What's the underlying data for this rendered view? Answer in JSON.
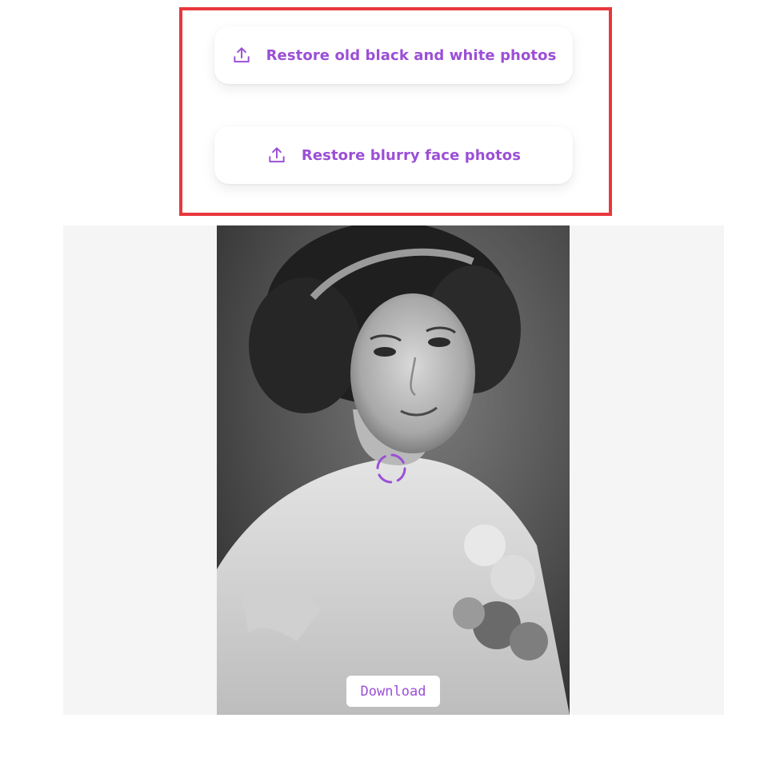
{
  "actions": {
    "restore_bw_label": "Restore old black and white photos",
    "restore_blurry_label": "Restore blurry face photos",
    "icon": "upload-icon"
  },
  "preview": {
    "download_label": "Download",
    "status": "loading",
    "image": "black-and-white portrait photo of a woman with headband and flowers"
  },
  "colors": {
    "accent": "#9b4fd6",
    "highlight": "#e8373c",
    "panel_bg": "#f5f5f5"
  }
}
